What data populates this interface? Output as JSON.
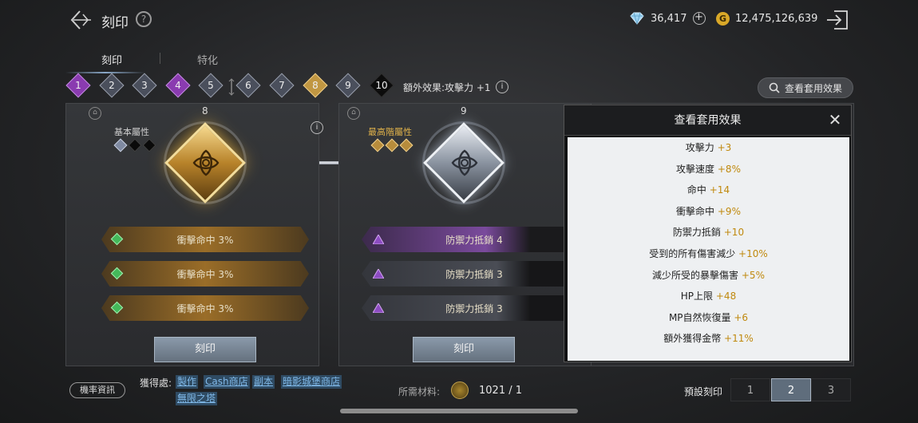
{
  "header": {
    "title": "刻印",
    "help_icon": "?",
    "diamond_count": "36,417",
    "plus": "+",
    "gold_symbol": "G",
    "gold_count": "12,475,126,639"
  },
  "tabs": [
    {
      "label": "刻印"
    },
    {
      "label": "特化"
    }
  ],
  "steps": [
    "1",
    "2",
    "3",
    "4",
    "5",
    "6",
    "7",
    "8",
    "9",
    "10"
  ],
  "extra_effect": "額外效果:攻擊力 +1",
  "info_glyph": "i",
  "view_set_button": "查看套用效果",
  "cards": [
    {
      "number": "8",
      "attr_label": "基本屬性",
      "stats": [
        "衝擊命中 3%",
        "衝擊命中 3%",
        "衝擊命中 3%"
      ],
      "button": "刻印"
    },
    {
      "number": "9",
      "attr_label": "最高階屬性",
      "stats": [
        "防禦力抵銷 4",
        "防禦力抵銷 3",
        "防禦力抵銷 3"
      ],
      "button": "刻印"
    }
  ],
  "panel": {
    "title": "查看套用效果",
    "close": "✕",
    "rows": [
      {
        "label": "攻擊力",
        "value": "+3"
      },
      {
        "label": "攻擊速度",
        "value": "+8%"
      },
      {
        "label": "命中",
        "value": "+14"
      },
      {
        "label": "衝擊命中",
        "value": "+9%"
      },
      {
        "label": "防禦力抵銷",
        "value": "+10"
      },
      {
        "label": "受到的所有傷害減少",
        "value": "+10%"
      },
      {
        "label": "減少所受的暴擊傷害",
        "value": "+5%"
      },
      {
        "label": "HP上限",
        "value": "+48"
      },
      {
        "label": "MP自然恢復量",
        "value": "+6"
      },
      {
        "label": "額外獲得金幣",
        "value": "+11%"
      }
    ]
  },
  "bottom": {
    "prob_button": "機率資訊",
    "source_label": "獲得處:",
    "sources": [
      "製作",
      "Cash商店",
      "副本",
      "暗影城堡商店",
      "無限之塔"
    ],
    "material_label": "所需材料:",
    "material_value": "1021 / 1",
    "preset_label": "預設刻印",
    "presets": [
      "1",
      "2",
      "3"
    ]
  },
  "colors": {
    "purple_step": "#8a3bb0",
    "gold_step": "#c19742",
    "value_gold": "#c0890e",
    "link_blue": "#7fb8e8"
  }
}
